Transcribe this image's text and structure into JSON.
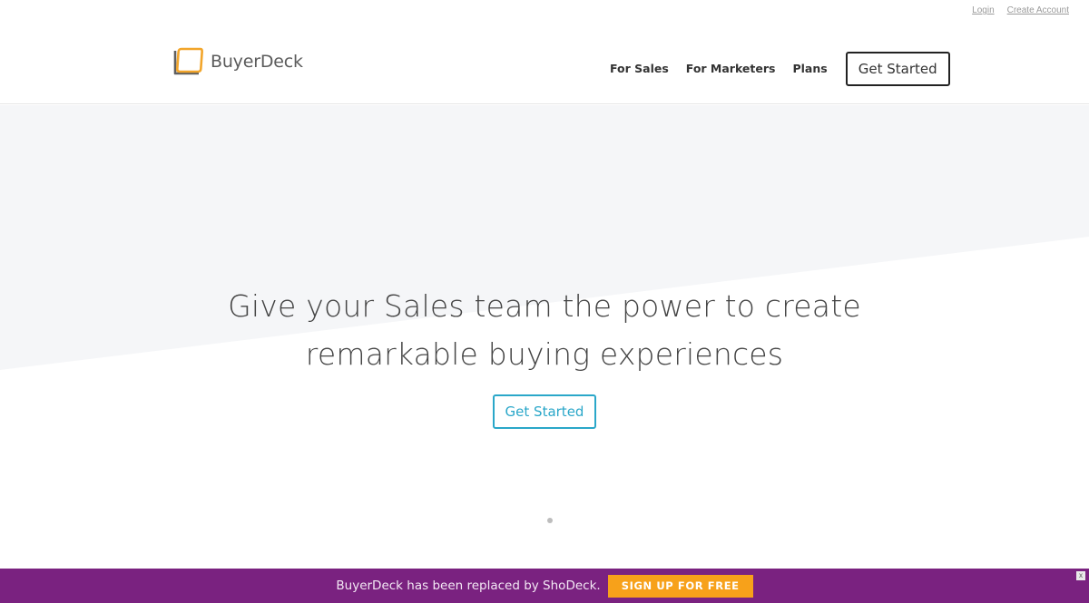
{
  "utility": {
    "login": "Login",
    "create_account": "Create Account"
  },
  "header": {
    "brand": "BuyerDeck",
    "nav": {
      "for_sales": "For Sales",
      "for_marketers": "For Marketers",
      "plans": "Plans",
      "cta": "Get Started"
    }
  },
  "hero": {
    "title_line1": "Give your Sales team the power to create",
    "title_line2": "remarkable buying experiences",
    "cta": "Get Started"
  },
  "banner": {
    "text": "BuyerDeck has been replaced by ShoDeck.",
    "button": "SIGN UP FOR FREE",
    "close": "x"
  },
  "colors": {
    "accent": "#2aa7c9",
    "banner_bg": "#7a2280",
    "banner_button": "#f7a11a",
    "logo_orange": "#f2a52a",
    "hero_band": "#f5f6f8"
  }
}
